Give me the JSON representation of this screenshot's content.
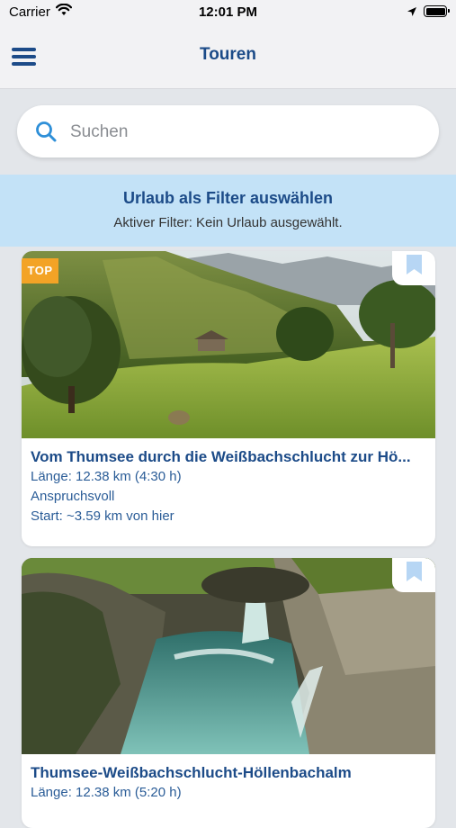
{
  "status": {
    "carrier": "Carrier",
    "time": "12:01 PM"
  },
  "nav": {
    "title": "Touren",
    "menu_icon": "hamburger-menu-icon"
  },
  "search": {
    "placeholder": "Suchen",
    "value": ""
  },
  "filter": {
    "title": "Urlaub als Filter auswählen",
    "subtitle": "Aktiver Filter: Kein Urlaub ausgewählt."
  },
  "tours": [
    {
      "badge": "TOP",
      "title": "Vom Thumsee durch die Weißbachschlucht zur Hö...",
      "length": "Länge: 12.38 km (4:30 h)",
      "difficulty": "Anspruchsvoll",
      "start": "Start: ~3.59 km von hier"
    },
    {
      "title": "Thumsee-Weißbachschlucht-Höllenbachalm",
      "length": "Länge: 12.38 km (5:20 h)"
    }
  ],
  "colors": {
    "accent": "#1c4b88",
    "banner": "#c3e2f7",
    "badge": "#f3a326"
  }
}
